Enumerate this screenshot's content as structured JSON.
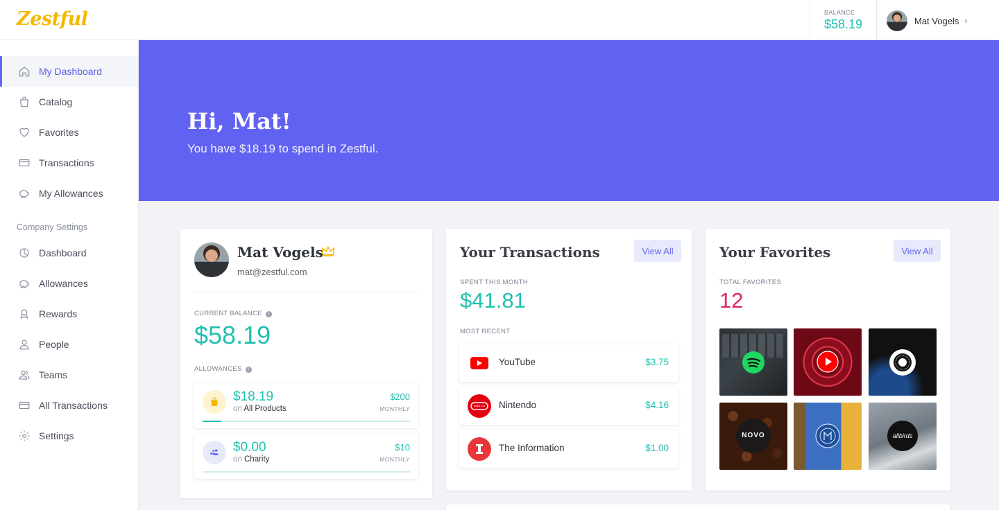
{
  "brand": {
    "logo": "Zestful",
    "logo_color": "#f5b800",
    "accent": "#6366f1",
    "money_color": "#1fc0b0"
  },
  "topbar": {
    "balance_label": "BALANCE",
    "balance_value": "$58.19",
    "user_name": "Mat Vogels",
    "chevron": "›"
  },
  "sidebar": {
    "items": [
      {
        "label": "My Dashboard",
        "icon": "home-icon"
      },
      {
        "label": "Catalog",
        "icon": "shopping-bag-icon"
      },
      {
        "label": "Favorites",
        "icon": "heart-icon"
      },
      {
        "label": "Transactions",
        "icon": "credit-card-icon"
      },
      {
        "label": "My Allowances",
        "icon": "piggy-bank-icon"
      }
    ],
    "section_label": "Company Settings",
    "settings_items": [
      {
        "label": "Dashboard",
        "icon": "pie-chart-icon"
      },
      {
        "label": "Allowances",
        "icon": "piggy-bank-icon"
      },
      {
        "label": "Rewards",
        "icon": "award-icon"
      },
      {
        "label": "People",
        "icon": "user-icon"
      },
      {
        "label": "Teams",
        "icon": "users-icon"
      },
      {
        "label": "All Transactions",
        "icon": "credit-card-icon"
      },
      {
        "label": "Settings",
        "icon": "gear-icon"
      }
    ]
  },
  "hero": {
    "greeting": "Hi, Mat!",
    "subtitle": "You have $18.19 to spend in Zestful."
  },
  "profile": {
    "name": "Mat Vogels",
    "email": "mat@zestful.com",
    "current_balance_label": "CURRENT BALANCE",
    "current_balance": "$58.19",
    "allowances_label": "ALLOWANCES",
    "allowances": [
      {
        "amount": "$18.19",
        "on": "on",
        "target": "All Products",
        "limit": "$200",
        "period": "MONTHLY",
        "progress": 0.09,
        "icon": "shopping-bag-icon"
      },
      {
        "amount": "$0.00",
        "on": "on",
        "target": "Charity",
        "limit": "$10",
        "period": "MONTHLY",
        "progress": 0.0,
        "icon": "charity-hand-icon"
      }
    ]
  },
  "transactions": {
    "title": "Your Transactions",
    "view_all": "View All",
    "spent_label": "SPENT THIS MONTH",
    "spent_value": "$41.81",
    "recent_label": "MOST RECENT",
    "items": [
      {
        "name": "YouTube",
        "amount": "$3.75",
        "icon": "youtube-icon"
      },
      {
        "name": "Nintendo",
        "amount": "$4.16",
        "icon": "nintendo-icon"
      },
      {
        "name": "The Information",
        "amount": "$1.00",
        "icon": "the-information-icon"
      }
    ]
  },
  "favorites": {
    "title": "Your Favorites",
    "view_all": "View All",
    "total_label": "TOTAL FAVORITES",
    "total_value": "12",
    "total_color": "#e0245e",
    "items": [
      {
        "name": "Spotify",
        "icon": "spotify-icon"
      },
      {
        "name": "YouTube Premium",
        "icon": "youtube-play-icon"
      },
      {
        "name": "Headspace",
        "icon": "circle-logo-icon"
      },
      {
        "name": "Novo Coffee",
        "text": "NOVO"
      },
      {
        "name": "Blue Bottle",
        "icon": "bottle-logo-icon"
      },
      {
        "name": "Allbirds",
        "text": "allbirds"
      }
    ]
  }
}
